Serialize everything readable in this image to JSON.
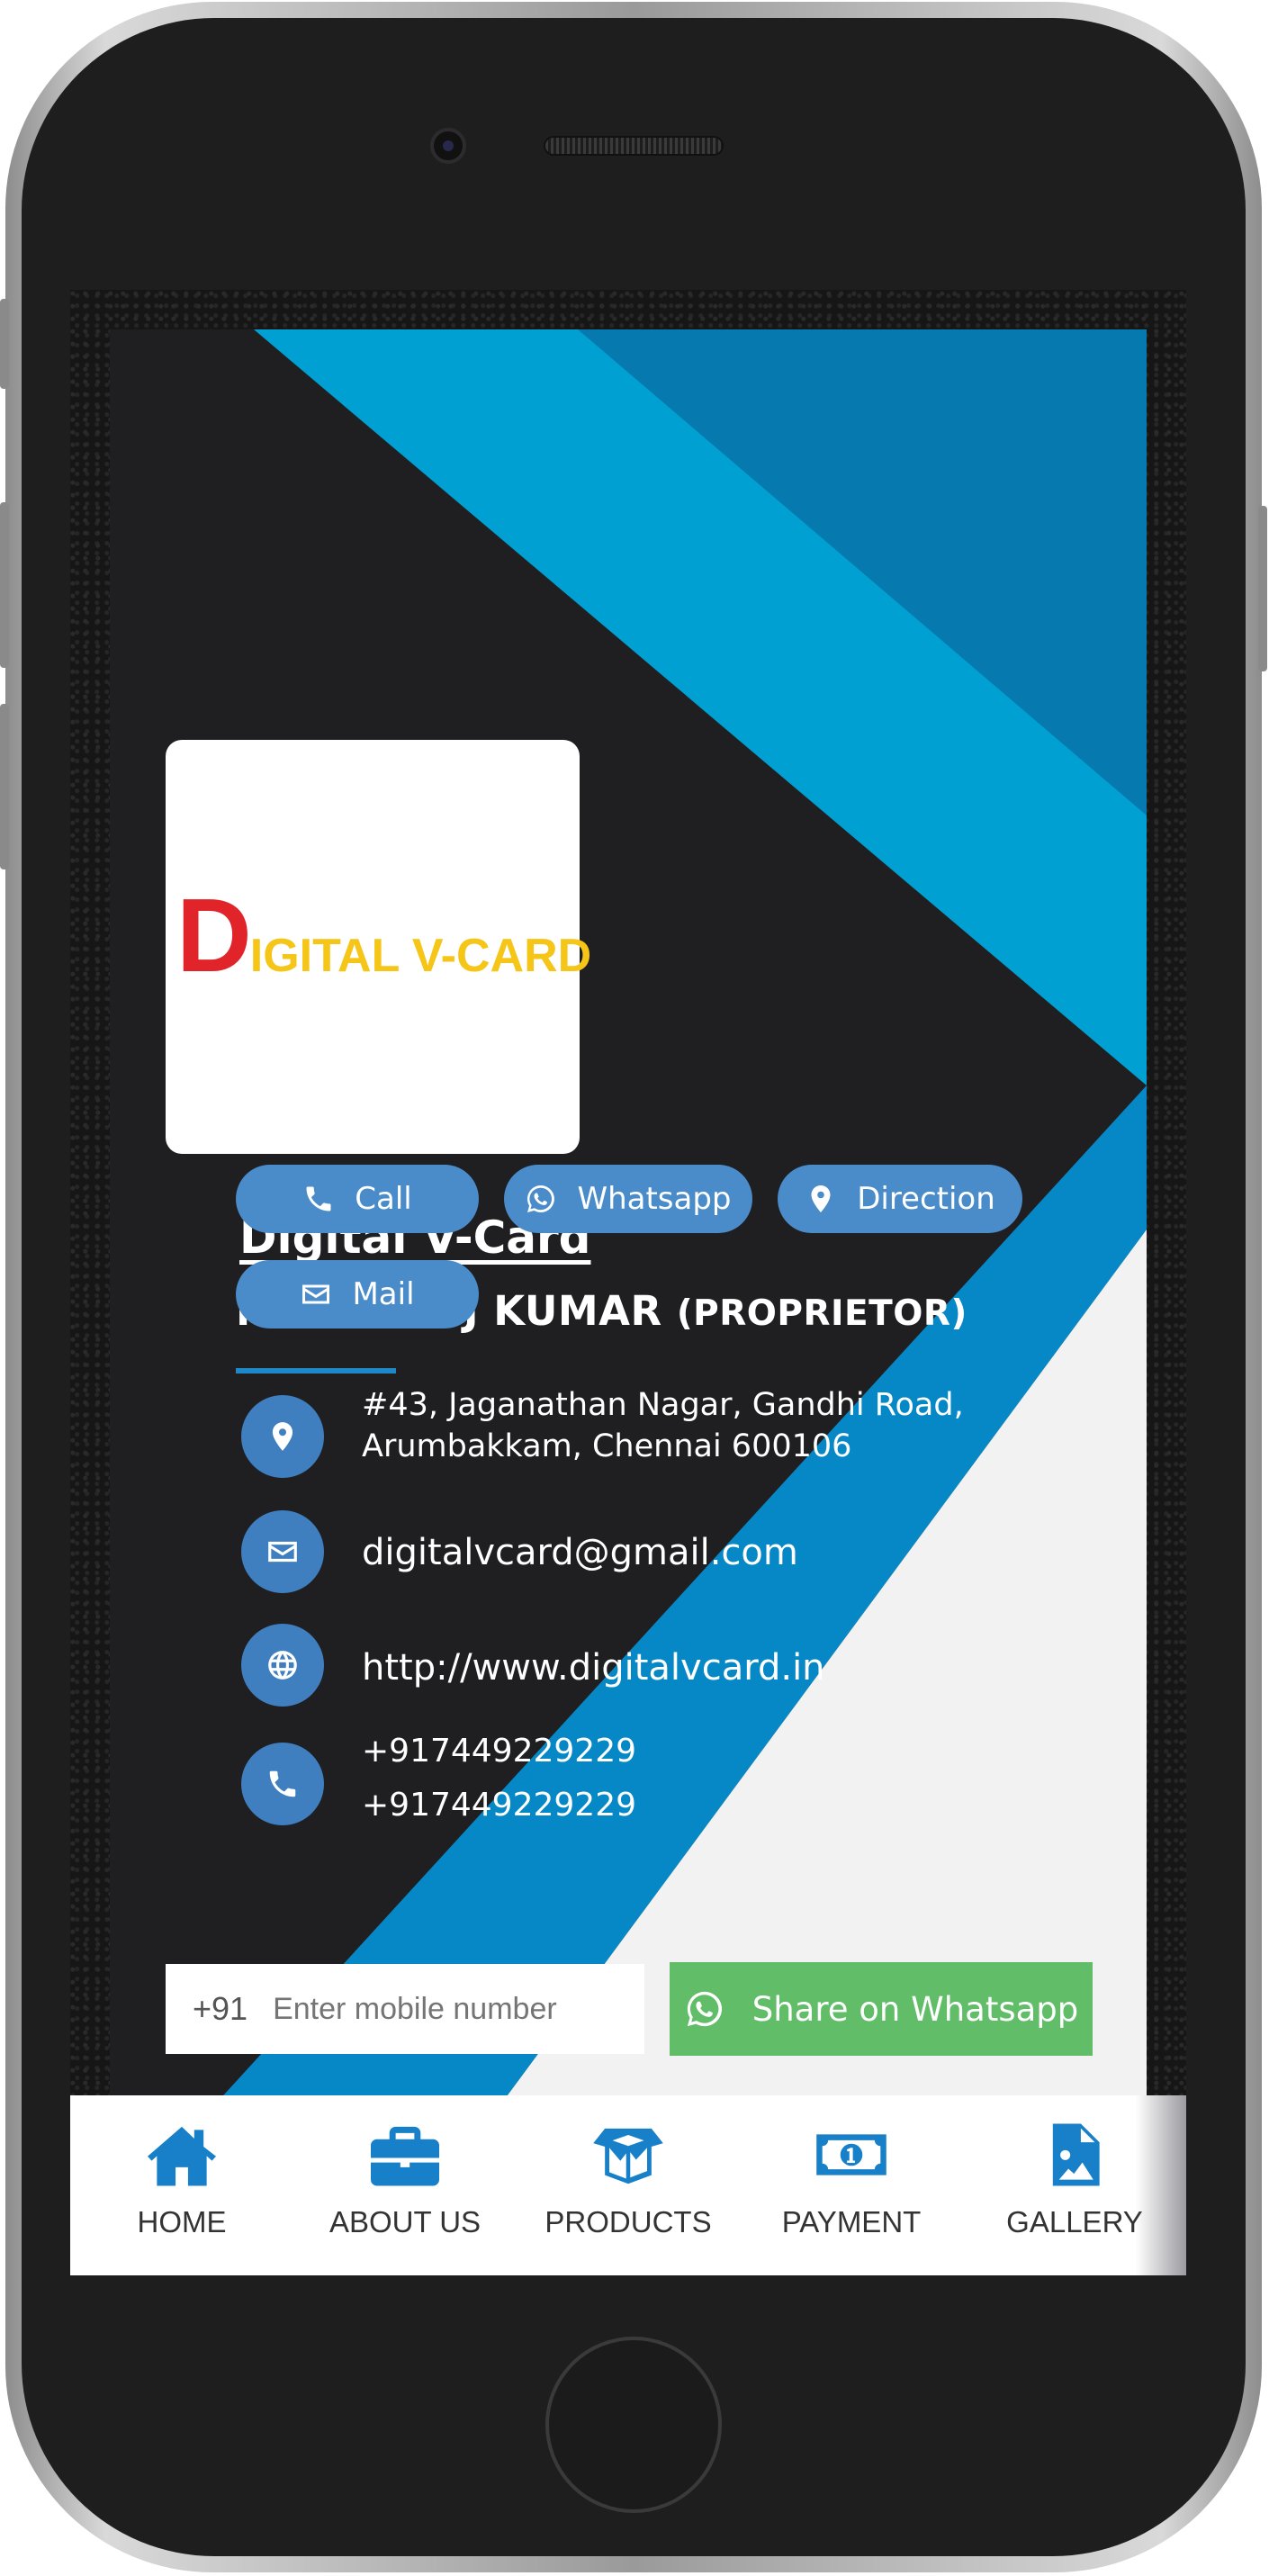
{
  "logo": {
    "initial": "D",
    "rest": "IGITAL V-CARD",
    "initial_color": "#e0242a",
    "rest_color": "#f5c518"
  },
  "profile": {
    "company": "Digital V-Card",
    "name": "Mr. MANOJ KUMAR",
    "role": "(PROPRIETOR)"
  },
  "actions": [
    {
      "label": "Call",
      "icon": "phone-icon"
    },
    {
      "label": "Whatsapp",
      "icon": "whatsapp-icon"
    },
    {
      "label": "Direction",
      "icon": "map-pin-icon"
    },
    {
      "label": "Mail",
      "icon": "envelope-icon"
    }
  ],
  "contact": {
    "address_line1": "#43, Jaganathan Nagar, Gandhi Road,",
    "address_line2": "Arumbakkam, Chennai 600106",
    "email": "digitalvcard@gmail.com",
    "website": "http://www.digitalvcard.in",
    "phone1": "+917449229229",
    "phone2": "+917449229229"
  },
  "share": {
    "country_code": "+91",
    "placeholder": "Enter mobile number",
    "button_label": "Share on Whatsapp"
  },
  "nav": [
    {
      "label": "HOME",
      "icon": "home-icon"
    },
    {
      "label": "ABOUT US",
      "icon": "briefcase-icon"
    },
    {
      "label": "PRODUCTS",
      "icon": "box-icon"
    },
    {
      "label": "PAYMENT",
      "icon": "money-icon"
    },
    {
      "label": "GALLERY",
      "icon": "image-file-icon"
    }
  ],
  "colors": {
    "accent_blue": "#1e88c9",
    "pill_blue": "#4a8bc9",
    "whatsapp_green": "#62bd69",
    "nav_icon_blue": "#1880c8",
    "card_dark": "#1f1e20"
  }
}
